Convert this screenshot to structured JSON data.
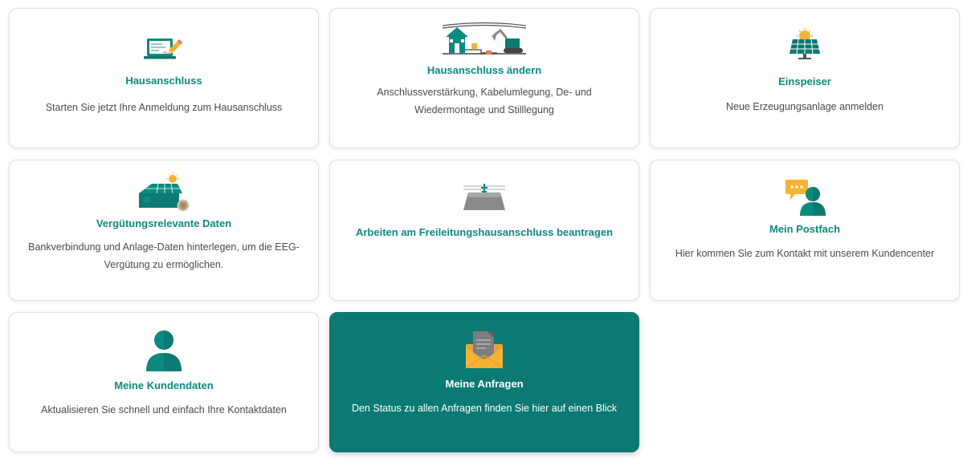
{
  "tiles": [
    {
      "title": "Hausanschluss",
      "description": "Starten Sie jetzt Ihre Anmeldung zum Hausanschluss",
      "icon": "laptop-pencil-icon"
    },
    {
      "title": "Hausanschluss ändern",
      "description": "Anschlussverstärkung, Kabelumlegung, De- und Wiedermontage und Stilllegung",
      "icon": "house-excavator-icon"
    },
    {
      "title": "Einspeiser",
      "description": "Neue Erzeugungsanlage anmelden",
      "icon": "solar-panel-icon"
    },
    {
      "title": "Vergütungsrelevante Daten",
      "description": "Bankverbindung und Anlage-Daten hinterlegen, um die EEG-Vergütung zu ermöglichen.",
      "icon": "solar-roof-coin-icon"
    },
    {
      "title": "Arbeiten am Freileitungshausanschluss beantragen",
      "description": "",
      "icon": "overhead-line-icon"
    },
    {
      "title": "Mein Postfach",
      "description": "Hier kommen Sie zum Kontakt mit unserem Kundencenter",
      "icon": "chat-person-icon"
    },
    {
      "title": "Meine Kundendaten",
      "description": "Aktualisieren Sie schnell und einfach Ihre Kontaktdaten",
      "icon": "person-icon"
    },
    {
      "title": "Meine Anfragen",
      "description": "Den Status zu allen Anfragen finden Sie hier auf einen Blick",
      "icon": "envelope-document-icon",
      "active": true
    }
  ],
  "colors": {
    "accent": "#0b8a80",
    "active_tile_background": "#0b7a72",
    "text": "#4b4b4b",
    "icon_yellow": "#f5b335",
    "icon_grey": "#8a8a8a"
  }
}
